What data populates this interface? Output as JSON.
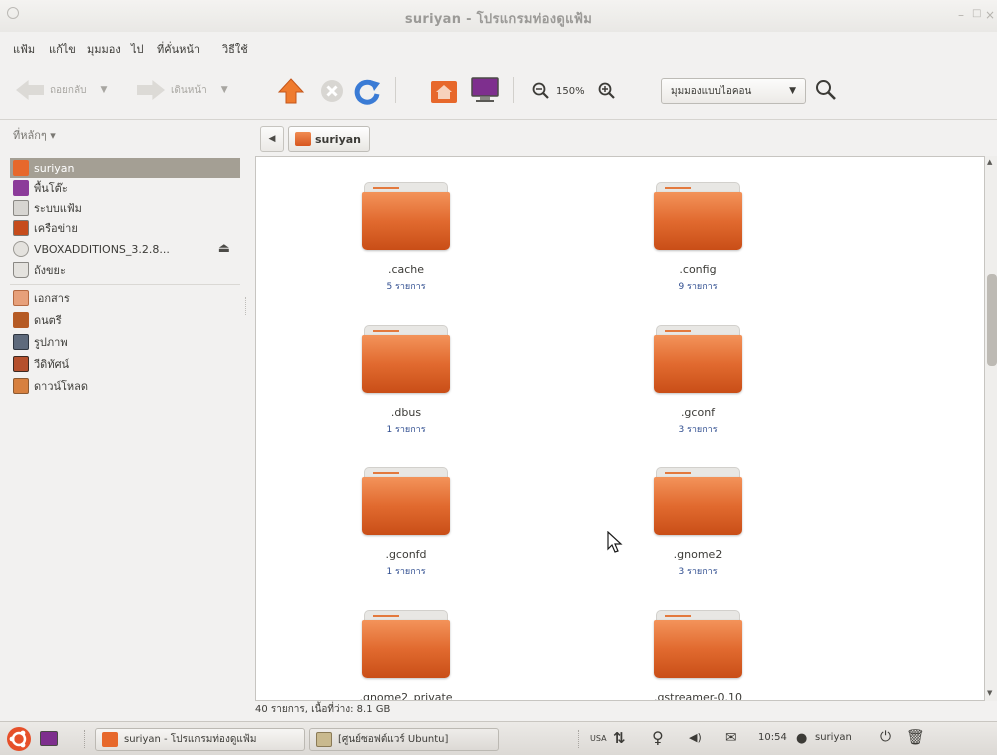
{
  "window": {
    "title": "suriyan - โปรแกรมท่องดูแฟ้ม"
  },
  "menubar": [
    "แฟ้ม",
    "แก้ไข",
    "มุมมอง",
    "ไป",
    "ที่คั่นหน้า",
    "วิธีใช้"
  ],
  "toolbar": {
    "back_label": "ถอยกลับ",
    "forward_label": "เดินหน้า",
    "zoom_level": "150%",
    "view_mode": "มุมมองแบบไอคอน",
    "icons": [
      "up-arrow-icon",
      "stop-icon",
      "reload-icon",
      "home-icon",
      "computer-icon",
      "zoom-out-icon",
      "zoom-in-icon",
      "search-icon"
    ]
  },
  "sidebar": {
    "header": "ที่หลักๆ",
    "items": [
      {
        "label": "suriyan",
        "icon": "home-folder-icon",
        "color": "#e7682b",
        "selected": true
      },
      {
        "label": "พื้นโต๊ะ",
        "icon": "desktop-icon",
        "color": "#8c3b9a"
      },
      {
        "label": "ระบบแฟ้ม",
        "icon": "filesystem-icon",
        "color": "#d7d5d1"
      },
      {
        "label": "เครือข่าย",
        "icon": "network-icon",
        "color": "#c64c1c"
      },
      {
        "label": "VBOXADDITIONS_3.2.8...",
        "icon": "cdrom-icon",
        "color": "#cfcdc9",
        "eject": "⏏"
      },
      {
        "label": "ถังขยะ",
        "icon": "trash-icon",
        "color": "#e4e2de"
      },
      {
        "label": "เอกสาร",
        "icon": "documents-folder-icon",
        "color": "#e7a07a"
      },
      {
        "label": "ดนตรี",
        "icon": "music-folder-icon",
        "color": "#b55a24"
      },
      {
        "label": "รูปภาพ",
        "icon": "pictures-folder-icon",
        "color": "#5e6a7c"
      },
      {
        "label": "วีดิทัศน์",
        "icon": "videos-folder-icon",
        "color": "#b5502d"
      },
      {
        "label": "ดาวน์โหลด",
        "icon": "downloads-folder-icon",
        "color": "#d7803f"
      }
    ]
  },
  "pathbar": {
    "crumb": "suriyan"
  },
  "folders": [
    {
      "name": ".cache",
      "count": "5 รายการ"
    },
    {
      "name": ".config",
      "count": "9 รายการ"
    },
    {
      "name": ".dbus",
      "count": "1 รายการ"
    },
    {
      "name": ".gconf",
      "count": "3 รายการ"
    },
    {
      "name": ".gconfd",
      "count": "1 รายการ"
    },
    {
      "name": ".gnome2",
      "count": "3 รายการ"
    },
    {
      "name": ".gnome2_private",
      "count": ""
    },
    {
      "name": ".gstreamer-0.10",
      "count": ""
    }
  ],
  "status": "40 รายการ, เนื้อที่ว่าง: 8.1 GB",
  "panel": {
    "tasks": [
      {
        "label": "suriyan - โปรแกรมท่องดูแฟ้ม",
        "icon": "file-manager-icon"
      },
      {
        "label": "[ศูนย์ซอฟต์แวร์ Ubuntu]",
        "icon": "software-center-icon"
      }
    ],
    "keyboard": "USA",
    "clock": "10:54",
    "user": "suriyan"
  },
  "colors": {
    "accent": "#e16a2f",
    "selection": "#a49f94",
    "link": "#2f4d8f"
  }
}
